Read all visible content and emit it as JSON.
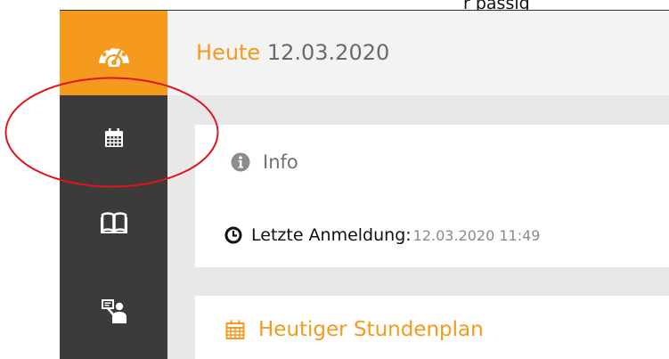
{
  "top_cut_text": "r passig",
  "sidebar": {
    "items": [
      {
        "icon": "dashboard-gauge-icon",
        "active": true
      },
      {
        "icon": "calendar-icon",
        "active": false
      },
      {
        "icon": "book-icon",
        "active": false
      },
      {
        "icon": "presenter-icon",
        "active": false
      }
    ]
  },
  "header": {
    "today_label": "Heute",
    "date": "12.03.2020"
  },
  "info_card": {
    "title": "Info",
    "last_login_label": "Letzte Anmeldung:",
    "last_login_value": "12.03.2020 11:49"
  },
  "schedule_card": {
    "title": "Heutiger Stundenplan"
  },
  "colors": {
    "accent": "#f59a1c",
    "sidebar": "#3b3b3b",
    "annotation": "#e0141e"
  }
}
